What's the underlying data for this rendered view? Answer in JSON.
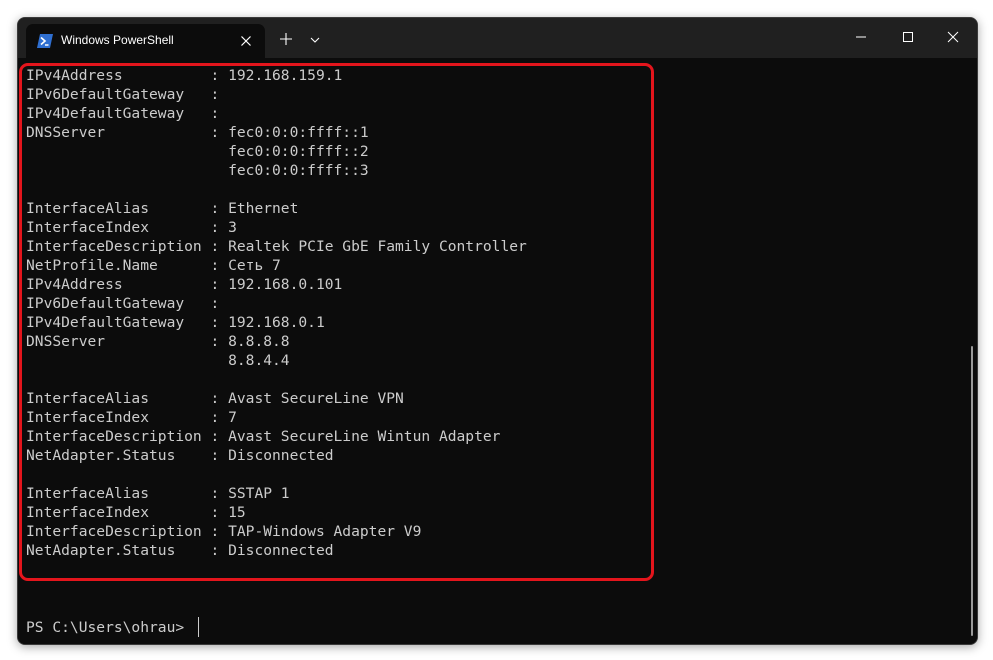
{
  "window": {
    "tab_title": "Windows PowerShell",
    "controls": {
      "minimize_icon": "minimize-icon",
      "maximize_icon": "maximize-icon",
      "close_icon": "close-icon"
    }
  },
  "terminal": {
    "lines": [
      "IPv4Address          : 192.168.159.1",
      "IPv6DefaultGateway   :",
      "IPv4DefaultGateway   :",
      "DNSServer            : fec0:0:0:ffff::1",
      "                       fec0:0:0:ffff::2",
      "                       fec0:0:0:ffff::3",
      "",
      "InterfaceAlias       : Ethernet",
      "InterfaceIndex       : 3",
      "InterfaceDescription : Realtek PCIe GbE Family Controller",
      "NetProfile.Name      : Сеть 7",
      "IPv4Address          : 192.168.0.101",
      "IPv6DefaultGateway   :",
      "IPv4DefaultGateway   : 192.168.0.1",
      "DNSServer            : 8.8.8.8",
      "                       8.8.4.4",
      "",
      "InterfaceAlias       : Avast SecureLine VPN",
      "InterfaceIndex       : 7",
      "InterfaceDescription : Avast SecureLine Wintun Adapter",
      "NetAdapter.Status    : Disconnected",
      "",
      "InterfaceAlias       : SSTAP 1",
      "InterfaceIndex       : 15",
      "InterfaceDescription : TAP-Windows Adapter V9",
      "NetAdapter.Status    : Disconnected"
    ],
    "prompt": "PS C:\\Users\\ohrau>"
  },
  "colors": {
    "terminal_bg": "#0c0c0c",
    "text": "#cccccc",
    "titlebar": "#202020",
    "highlight": "#e4151c"
  }
}
